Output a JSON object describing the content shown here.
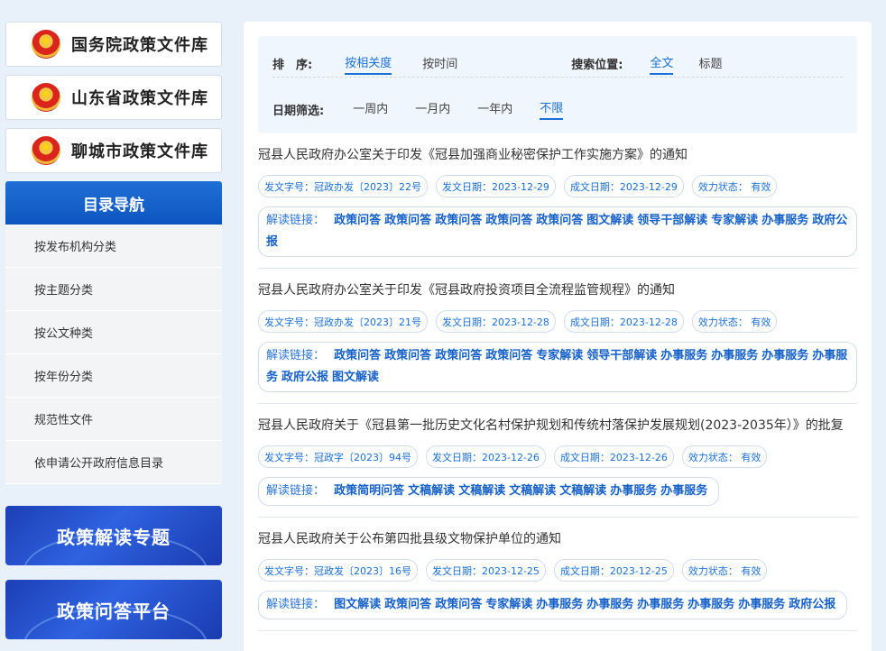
{
  "sidebar": {
    "libraries": [
      {
        "label": "国务院政策文件库"
      },
      {
        "label": "山东省政策文件库"
      },
      {
        "label": "聊城市政策文件库"
      }
    ],
    "nav_title": "目录导航",
    "nav_items": [
      {
        "label": "按发布机构分类"
      },
      {
        "label": "按主题分类"
      },
      {
        "label": "按公文种类"
      },
      {
        "label": "按年份分类"
      },
      {
        "label": "规范性文件"
      },
      {
        "label": "依申请公开政府信息目录"
      }
    ],
    "banners": [
      {
        "label": "政策解读专题"
      },
      {
        "label": "政策问答平台"
      }
    ]
  },
  "filter": {
    "sort_label": "排　序:",
    "sort_options": [
      "按相关度",
      "按时间"
    ],
    "sort_active": "按相关度",
    "position_label": "搜索位置:",
    "position_options": [
      "全文",
      "标题"
    ],
    "position_active": "全文",
    "date_label": "日期筛选:",
    "date_options": [
      "一周内",
      "一月内",
      "一年内",
      "不限"
    ],
    "date_active": "不限"
  },
  "docs": [
    {
      "title": "冠县人民政府办公室关于印发《冠县加强商业秘密保护工作实施方案》的通知",
      "doc_no": "发文字号：冠政办发〔2023〕22号",
      "pub_date": "发文日期：2023-12-29",
      "made_date": "成文日期：2023-12-29",
      "status": "效力状态：  有效",
      "links_label": "解读链接：",
      "links": [
        "政策问答",
        "政策问答",
        "政策问答",
        "政策问答",
        "政策问答",
        "图文解读",
        "领导干部解读",
        "专家解读",
        "办事服务",
        "政府公报"
      ]
    },
    {
      "title": "冠县人民政府办公室关于印发《冠县政府投资项目全流程监管规程》的通知",
      "doc_no": "发文字号：冠政办发〔2023〕21号",
      "pub_date": "发文日期：2023-12-28",
      "made_date": "成文日期：2023-12-28",
      "status": "效力状态：  有效",
      "links_label": "解读链接：",
      "links": [
        "政策问答",
        "政策问答",
        "政策问答",
        "政策问答",
        "专家解读",
        "领导干部解读",
        "办事服务",
        "办事服务",
        "办事服务",
        "办事服务",
        "政府公报",
        "图文解读"
      ]
    },
    {
      "title": "冠县人民政府关于《冠县第一批历史文化名村保护规划和传统村落保护发展规划(2023-2035年）》的批复",
      "doc_no": "发文字号：冠政字〔2023〕94号",
      "pub_date": "发文日期：2023-12-26",
      "made_date": "成文日期：2023-12-26",
      "status": "效力状态：  有效",
      "links_label": "解读链接：",
      "links": [
        "政策简明问答",
        "文稿解读",
        "文稿解读",
        "文稿解读",
        "文稿解读",
        "办事服务",
        "办事服务"
      ]
    },
    {
      "title": "冠县人民政府关于公布第四批县级文物保护单位的通知",
      "doc_no": "发文字号：冠政发〔2023〕16号",
      "pub_date": "发文日期：2023-12-25",
      "made_date": "成文日期：2023-12-25",
      "status": "效力状态：  有效",
      "links_label": "解读链接：",
      "links": [
        "图文解读",
        "政策问答",
        "政策问答",
        "专家解读",
        "办事服务",
        "办事服务",
        "办事服务",
        "办事服务",
        "办事服务",
        "政府公报"
      ]
    }
  ]
}
